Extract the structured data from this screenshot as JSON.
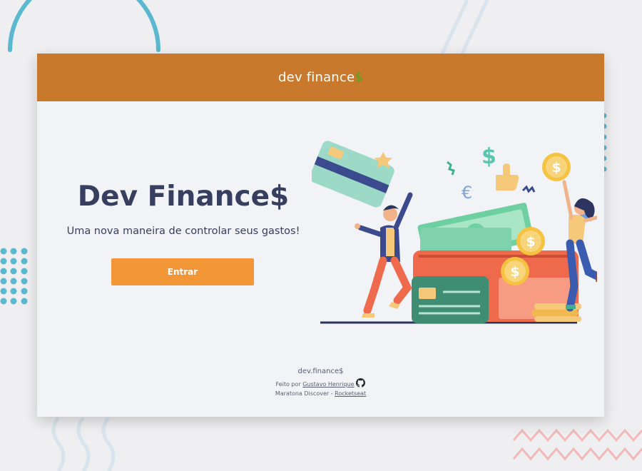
{
  "header": {
    "logo_main": "dev finance",
    "logo_accent": "$"
  },
  "hero": {
    "title": "Dev Finance$",
    "subtitle": "Uma nova maneira de controlar seus gastos!",
    "button_label": "Entrar"
  },
  "illustration": {
    "icons": [
      "credit-card-icon",
      "wallet-icon",
      "coin-icon",
      "dollar-icon",
      "euro-icon",
      "star-icon",
      "thumbs-up-icon"
    ]
  },
  "footer": {
    "brand": "dev.finance$",
    "made_by_prefix": "Feito por",
    "author": "Gustavo Henrique",
    "event_prefix": "Maratona Discover -",
    "org": "Rocketseat"
  },
  "colors": {
    "header": "#c8792b",
    "accent": "#49aa26",
    "button": "#f39638",
    "title": "#363f5f",
    "background": "#efeff1"
  }
}
